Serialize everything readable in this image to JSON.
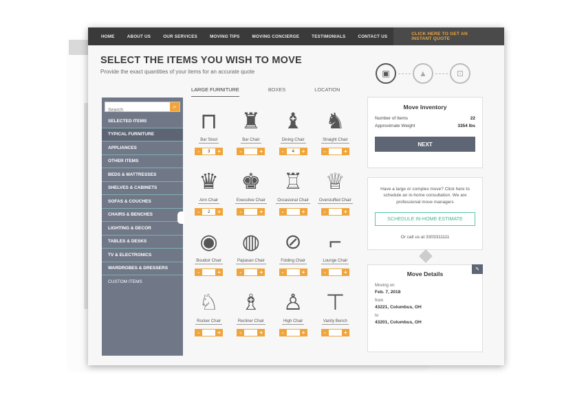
{
  "nav": {
    "items": [
      "HOME",
      "ABOUT US",
      "OUR SERVICES",
      "MOVING TIPS",
      "MOVING CONCIERGE",
      "TESTIMONIALS",
      "CONTACT US"
    ],
    "cta": "CLICK HERE TO GET AN INSTANT QUOTE"
  },
  "page": {
    "title": "SELECT THE ITEMS YOU WISH TO MOVE",
    "subtitle": "Provide the exact quantities of your items for an accurate quote"
  },
  "tabs": [
    "LARGE FURNITURE",
    "BOXES",
    "LOCATION"
  ],
  "sidebar": {
    "search_placeholder": "Search",
    "categories": [
      "SELECTED ITEMS",
      "TYPICAL FURNITURE",
      "APPLIANCES",
      "OTHER ITEMS",
      "BEDS & MATTRESSES",
      "SHELVES & CABINETS",
      "SOFAS & COUCHES",
      "CHAIRS & BENCHES",
      "LIGHTING & DECOR",
      "TABLES & DESKS",
      "TV & ELECTRONICS",
      "WARDROBES & DRESSERS",
      "CUSTOM ITEMS"
    ]
  },
  "items": [
    {
      "name": "Bar Stool",
      "qty": "3",
      "icon": "bar-stool-icon"
    },
    {
      "name": "Bar Chair",
      "qty": "",
      "icon": "bar-chair-icon"
    },
    {
      "name": "Dining Chair",
      "qty": "4",
      "icon": "dining-chair-icon"
    },
    {
      "name": "Straight Chair",
      "qty": "",
      "icon": "straight-chair-icon"
    },
    {
      "name": "Arm Chair",
      "qty": "2",
      "icon": "arm-chair-icon"
    },
    {
      "name": "Executive Chair",
      "qty": "",
      "icon": "executive-chair-icon"
    },
    {
      "name": "Occasional Chair",
      "qty": "",
      "icon": "occasional-chair-icon"
    },
    {
      "name": "Overstuffed Chair",
      "qty": "",
      "icon": "overstuffed-chair-icon"
    },
    {
      "name": "Boudoir Chair",
      "qty": "",
      "icon": "boudoir-chair-icon"
    },
    {
      "name": "Papasan Chair",
      "qty": "",
      "icon": "papasan-chair-icon"
    },
    {
      "name": "Folding Chair",
      "qty": "",
      "icon": "folding-chair-icon"
    },
    {
      "name": "Lounge Chair",
      "qty": "",
      "icon": "lounge-chair-icon"
    },
    {
      "name": "Rocker Chair",
      "qty": "",
      "icon": "rocker-chair-icon"
    },
    {
      "name": "Recliner Chair",
      "qty": "",
      "icon": "recliner-chair-icon"
    },
    {
      "name": "High Chair",
      "qty": "",
      "icon": "high-chair-icon"
    },
    {
      "name": "Vanity Bench",
      "qty": "",
      "icon": "vanity-bench-icon"
    }
  ],
  "qty_controls": {
    "minus": "-",
    "plus": "+"
  },
  "inventory": {
    "title": "Move Inventory",
    "items_label": "Number of Items",
    "items_value": "22",
    "weight_label": "Approximate Weight",
    "weight_value": "3354 lbs",
    "next_label": "NEXT"
  },
  "consult": {
    "text": "Have a large or complex move? Click here to schedule an in-home consultation. We are professional move managers",
    "button": "SCHEDULE IN-HOME ESTIMATE",
    "call": "Or call us at 3303311111"
  },
  "details": {
    "title": "Move Details",
    "moving_on_label": "Moving on",
    "moving_on_value": "Feb. 7, 2018",
    "from_label": "from",
    "from_value": "43221, Columbus, OH",
    "to_label": "to",
    "to_value": "43201, Columbus, OH"
  },
  "colors": {
    "accent": "#f0a53c",
    "nav_bg": "#3a3a3a",
    "sidebar_bg": "#707888",
    "sidebar_divider": "#7fb2b3",
    "button_dark": "#5e6675",
    "estimate_green": "#43b48d"
  }
}
